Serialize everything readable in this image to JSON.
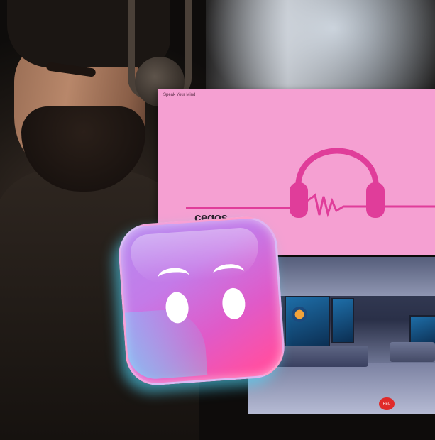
{
  "pink_panel": {
    "title": "Speak Your Mind",
    "logo_text": "cegos"
  },
  "room_panel": {
    "record_button": "REC"
  },
  "icons": [
    "headphones-icon",
    "app-face-icon"
  ],
  "colors": {
    "pink_background": "#f5a0d2",
    "headphone_pink": "#e03d9a",
    "icon_gradient_start": "#b78bf0",
    "icon_gradient_end": "#ff4fa3",
    "icon_glow": "#50dcff",
    "record_red": "#e02a2a"
  }
}
